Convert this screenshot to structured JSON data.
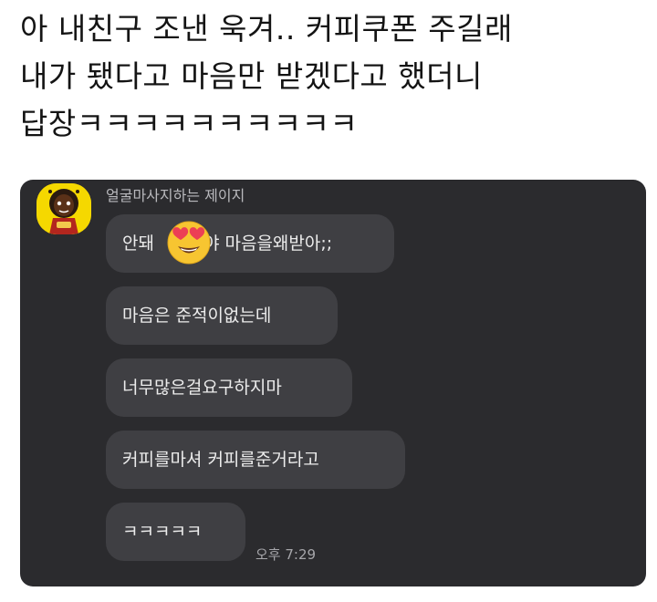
{
  "post": {
    "caption_lines": [
      "아 내친구 조낸 욱겨.. 커피쿠폰 주길래",
      "내가 됐다고 마음만 받겠다고 했더니",
      "답장ㅋㅋㅋㅋㅋㅋㅋㅋㅋㅋ"
    ]
  },
  "chat": {
    "sender_name": "얼굴마사지하는 제이지",
    "avatar_icon": "cartoon-character-avatar",
    "messages": [
      {
        "before_emoji": "안돼",
        "emoji": "heart-eyes-emoji",
        "after_emoji": "야 마음을왜받아;;"
      },
      {
        "text": "마음은 준적이없는데"
      },
      {
        "text": "너무많은걸요구하지마"
      },
      {
        "text": "커피를마셔 커피를준거라고"
      },
      {
        "text": "ㅋㅋㅋㅋㅋ"
      }
    ],
    "timestamp": "오후 7:29"
  },
  "colors": {
    "panel_bg": "#2b2b2e",
    "bubble_bg": "#3f3f43",
    "avatar_bg": "#f5d800"
  }
}
